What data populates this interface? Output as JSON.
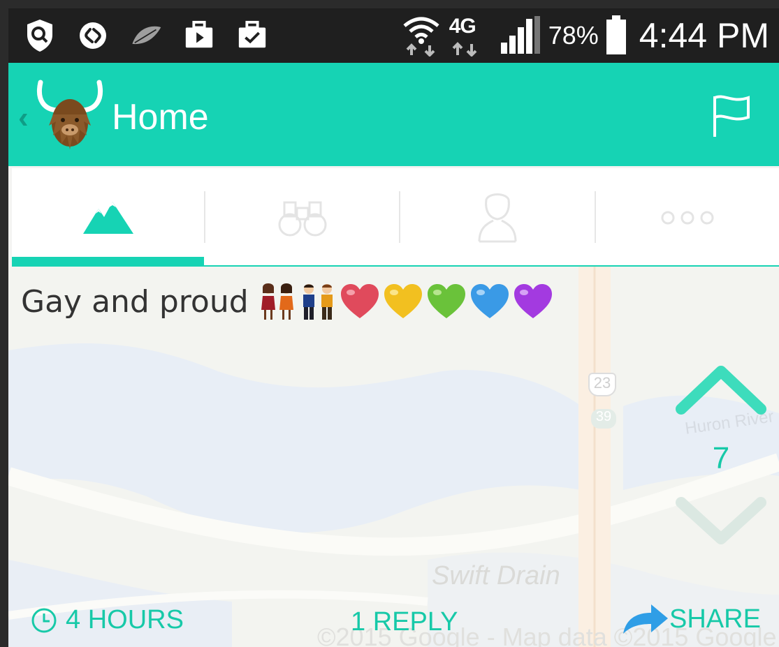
{
  "status_bar": {
    "icons": [
      "shield-search-icon",
      "shazam-icon",
      "leaf-icon",
      "video-briefcase-icon",
      "check-briefcase-icon",
      "wifi-icon",
      "4g-lte-icon",
      "signal-icon",
      "battery-icon"
    ],
    "network": "4G",
    "battery_percent": "78%",
    "time": "4:44 PM"
  },
  "app_bar": {
    "title": "Home",
    "icons": [
      "back-chevron-icon",
      "yak-logo",
      "flag-icon"
    ],
    "color": "#16d3b4"
  },
  "tabs": [
    {
      "name": "mountains-icon",
      "active": true
    },
    {
      "name": "binoculars-icon",
      "active": false
    },
    {
      "name": "profile-icon",
      "active": false
    },
    {
      "name": "more-icon",
      "active": false
    }
  ],
  "post": {
    "text": "Gay and proud",
    "emojis": [
      "two-women-holding-hands",
      "two-men-holding-hands",
      "red-heart",
      "yellow-heart",
      "green-heart",
      "blue-heart",
      "purple-heart"
    ],
    "vote_count": "7",
    "age": "4 HOURS",
    "replies": "1 REPLY",
    "share": "SHARE"
  },
  "map": {
    "labels": {
      "highway_23": "23",
      "highway_39": "39",
      "river": "Huron River",
      "drain": "Swift Drain",
      "attribution": "©2015 Google - Map data ©2015 Google"
    }
  },
  "accent_color": "#17c9a8"
}
